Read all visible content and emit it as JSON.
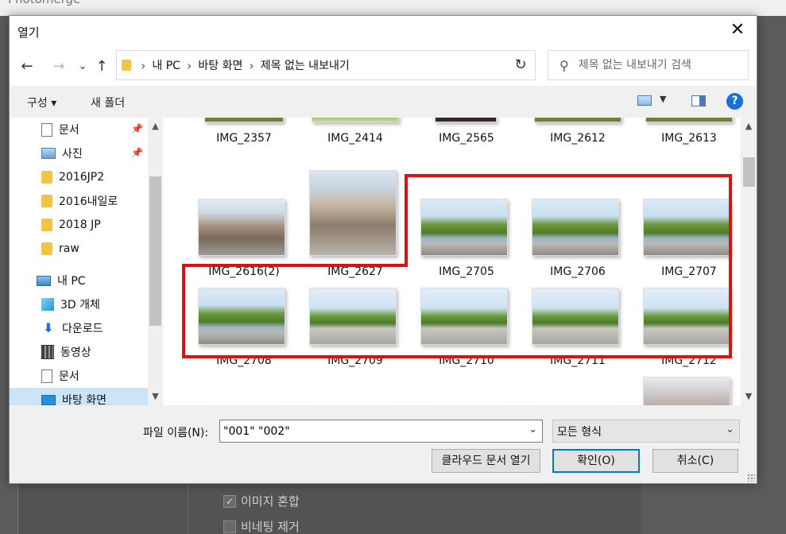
{
  "background": {
    "app_title": "Photomerge",
    "options": [
      {
        "label": "이미지 혼합",
        "checked": true
      },
      {
        "label": "비네팅 제거",
        "checked": false
      }
    ]
  },
  "dialog": {
    "title": "열기",
    "close_label": "✕",
    "nav": {
      "back": "←",
      "forward": "→",
      "recent": "⌄",
      "up": "↑",
      "breadcrumb": [
        "내 PC",
        "바탕 화면",
        "제목 없는 내보내기"
      ],
      "refresh": "↻",
      "search_placeholder": "제목 없는 내보내기 검색"
    },
    "toolbar": {
      "organize": "구성 ▾",
      "new_folder": "새 폴더",
      "help": "?"
    },
    "sidebar": {
      "items": [
        {
          "label": "문서",
          "icon": "document-icon",
          "pinned": true
        },
        {
          "label": "사진",
          "icon": "pictures-icon",
          "pinned": true
        },
        {
          "label": "2016JP2",
          "icon": "folder-icon",
          "pinned": false
        },
        {
          "label": "2016내일로",
          "icon": "folder-icon",
          "pinned": false
        },
        {
          "label": "2018 JP",
          "icon": "folder-icon",
          "pinned": false
        },
        {
          "label": "raw",
          "icon": "folder-icon",
          "pinned": false
        },
        {
          "label": "내 PC",
          "icon": "pc-icon",
          "pinned": false
        },
        {
          "label": "3D 개체",
          "icon": "cube-icon",
          "pinned": false
        },
        {
          "label": "다운로드",
          "icon": "download-icon",
          "pinned": false
        },
        {
          "label": "동영상",
          "icon": "video-icon",
          "pinned": false
        },
        {
          "label": "문서",
          "icon": "document-icon",
          "pinned": false
        },
        {
          "label": "바탕 화면",
          "icon": "desktop-icon",
          "pinned": false,
          "selected": true
        }
      ]
    },
    "files": {
      "row1": [
        "IMG_2357",
        "IMG_2414",
        "IMG_2565",
        "IMG_2612",
        "IMG_2613"
      ],
      "row2": [
        "IMG_2616(2)",
        "IMG_2627",
        "IMG_2705",
        "IMG_2706",
        "IMG_2707"
      ],
      "row3": [
        "IMG_2708",
        "IMG_2709",
        "IMG_2710",
        "IMG_2711",
        "IMG_2712"
      ]
    },
    "footer": {
      "filename_label": "파일 이름(N):",
      "filename_value": "\"001\" \"002\"",
      "filetype_value": "모든 형식",
      "cloud_button": "클라우드 문서 열기",
      "ok_button": "확인(O)",
      "cancel_button": "취소(C)"
    }
  },
  "colors": {
    "highlight": "#e11010",
    "selection": "#cce4f7",
    "accent": "#0078d7"
  }
}
